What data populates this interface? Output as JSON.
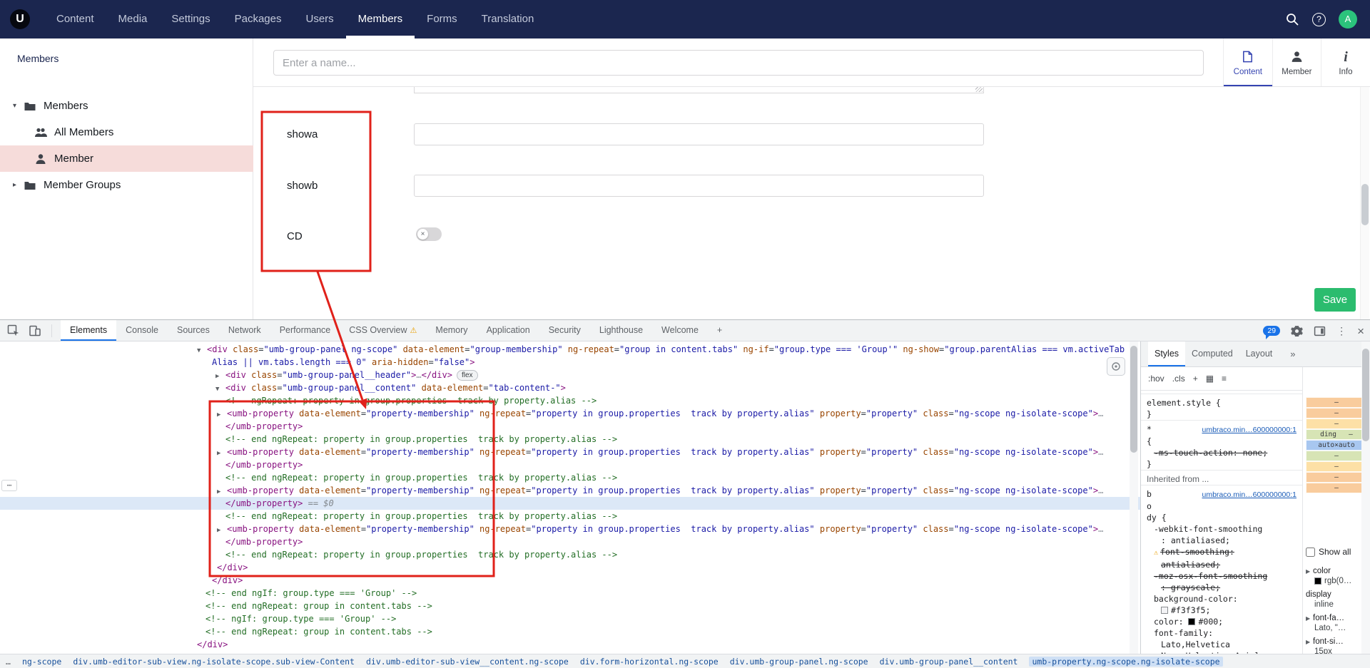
{
  "colors": {
    "header_bg": "#1b264f",
    "accent_blue": "#3544b1",
    "save_green": "#2bbc6e",
    "annotation_red": "#e0211a",
    "selected_tree_bg": "#f6dcda",
    "devtools_blue": "#1a73e8"
  },
  "topnav": {
    "logo_text": "U",
    "items": [
      "Content",
      "Media",
      "Settings",
      "Packages",
      "Users",
      "Members",
      "Forms",
      "Translation"
    ],
    "active_item": "Members",
    "avatar_initial": "A",
    "help_glyph": "?"
  },
  "sidebar": {
    "title": "Members",
    "tree": [
      {
        "label": "Members",
        "icon": "folder-icon",
        "caret": "▾",
        "child": false,
        "selected": false
      },
      {
        "label": "All Members",
        "icon": "members-icon",
        "child": true,
        "selected": false
      },
      {
        "label": "Member",
        "icon": "user-icon",
        "child": true,
        "selected": true
      },
      {
        "label": "Member Groups",
        "icon": "folder-icon",
        "caret": "▸",
        "child": false,
        "selected": false
      }
    ]
  },
  "editor": {
    "name_placeholder": "Enter a name...",
    "subtabs": [
      {
        "label": "Content",
        "icon": "document-icon",
        "active": true
      },
      {
        "label": "Member",
        "icon": "person-icon",
        "active": false
      },
      {
        "label": "Info",
        "icon": "info-icon",
        "active": false
      }
    ],
    "fields": [
      {
        "label": "showa",
        "type": "text",
        "value": ""
      },
      {
        "label": "showb",
        "type": "text",
        "value": ""
      },
      {
        "label": "CD",
        "type": "toggle",
        "state": "off",
        "knob_glyph": "×"
      }
    ],
    "save_label": "Save"
  },
  "devtools": {
    "tabs": [
      {
        "label": "Elements",
        "active": true
      },
      {
        "label": "Console"
      },
      {
        "label": "Sources"
      },
      {
        "label": "Network"
      },
      {
        "label": "Performance"
      },
      {
        "label": "CSS Overview",
        "warn": true
      },
      {
        "label": "Memory"
      },
      {
        "label": "Application"
      },
      {
        "label": "Security"
      },
      {
        "label": "Lighthouse"
      },
      {
        "label": "Welcome"
      },
      {
        "label": "+"
      }
    ],
    "issues_count": "29",
    "more_dots": "⋯",
    "close_glyph": "×",
    "kebab_glyph": "⋮",
    "code_lines": [
      {
        "ind": 0,
        "arrow": "▼",
        "toks": [
          [
            "t",
            "<div"
          ],
          [
            "at",
            " class"
          ],
          [
            "p",
            "="
          ],
          [
            "s",
            "\"umb-group-panel ng-scope\""
          ],
          [
            "at",
            " data-element"
          ],
          [
            "p",
            "="
          ],
          [
            "s",
            "\"group-membership\""
          ],
          [
            "at",
            " ng-repeat"
          ],
          [
            "p",
            "="
          ],
          [
            "s",
            "\"group in content.tabs\""
          ],
          [
            "at",
            " ng-if"
          ],
          [
            "p",
            "="
          ],
          [
            "s",
            "\"group.type === 'Group'\""
          ],
          [
            "at",
            " ng-show"
          ],
          [
            "p",
            "="
          ],
          [
            "s",
            "\"group.parentAlias === vm.activeTab"
          ]
        ]
      },
      {
        "ind": 21,
        "toks": [
          [
            "s",
            "Alias || vm.tabs.length === 0\""
          ],
          [
            "at",
            " aria-hidden"
          ],
          [
            "p",
            "="
          ],
          [
            "s",
            "\"false\""
          ],
          [
            "t",
            ">"
          ]
        ]
      },
      {
        "ind": 26,
        "arrow": "▶",
        "toks": [
          [
            "t",
            "<div"
          ],
          [
            "at",
            " class"
          ],
          [
            "p",
            "="
          ],
          [
            "s",
            "\"umb-group-panel__header\""
          ],
          [
            "t",
            ">"
          ],
          [
            "e",
            "…"
          ],
          [
            "t",
            "</div>"
          ],
          [
            "b",
            "flex"
          ]
        ]
      },
      {
        "ind": 26,
        "arrow": "▼",
        "toks": [
          [
            "t",
            "<div"
          ],
          [
            "at",
            " class"
          ],
          [
            "p",
            "="
          ],
          [
            "s",
            "\"umb-group-panel__content\""
          ],
          [
            "at",
            " data-element"
          ],
          [
            "p",
            "="
          ],
          [
            "s",
            "\"tab-content-\""
          ],
          [
            "t",
            ">"
          ]
        ]
      },
      {
        "ind": 40,
        "toks": [
          [
            "c",
            "<!-- ngRepeat: property in group.properties  track by property.alias -->"
          ]
        ]
      },
      {
        "ind": 28,
        "arrow": "▶",
        "toks": [
          [
            "t",
            "<umb-property"
          ],
          [
            "at",
            " data-element"
          ],
          [
            "p",
            "="
          ],
          [
            "s",
            "\"property-membership\""
          ],
          [
            "at",
            " ng-repeat"
          ],
          [
            "p",
            "="
          ],
          [
            "s",
            "\"property in group.properties  track by property.alias\""
          ],
          [
            "at",
            " property"
          ],
          [
            "p",
            "="
          ],
          [
            "s",
            "\"property\""
          ],
          [
            "at",
            " class"
          ],
          [
            "p",
            "="
          ],
          [
            "s",
            "\"ng-scope ng-isolate-scope\""
          ],
          [
            "t",
            ">"
          ],
          [
            "e",
            "…"
          ]
        ]
      },
      {
        "ind": 40,
        "toks": [
          [
            "t",
            "</umb-property>"
          ]
        ]
      },
      {
        "ind": 40,
        "toks": [
          [
            "c",
            "<!-- end ngRepeat: property in group.properties  track by property.alias -->"
          ]
        ]
      },
      {
        "ind": 28,
        "arrow": "▶",
        "toks": [
          [
            "t",
            "<umb-property"
          ],
          [
            "at",
            " data-element"
          ],
          [
            "p",
            "="
          ],
          [
            "s",
            "\"property-membership\""
          ],
          [
            "at",
            " ng-repeat"
          ],
          [
            "p",
            "="
          ],
          [
            "s",
            "\"property in group.properties  track by property.alias\""
          ],
          [
            "at",
            " property"
          ],
          [
            "p",
            "="
          ],
          [
            "s",
            "\"property\""
          ],
          [
            "at",
            " class"
          ],
          [
            "p",
            "="
          ],
          [
            "s",
            "\"ng-scope ng-isolate-scope\""
          ],
          [
            "t",
            ">"
          ],
          [
            "e",
            "…"
          ]
        ]
      },
      {
        "ind": 40,
        "toks": [
          [
            "t",
            "</umb-property>"
          ]
        ]
      },
      {
        "ind": 40,
        "toks": [
          [
            "c",
            "<!-- end ngRepeat: property in group.properties  track by property.alias -->"
          ]
        ]
      },
      {
        "ind": 28,
        "arrow": "▶",
        "toks": [
          [
            "t",
            "<umb-property"
          ],
          [
            "at",
            " data-element"
          ],
          [
            "p",
            "="
          ],
          [
            "s",
            "\"property-membership\""
          ],
          [
            "at",
            " ng-repeat"
          ],
          [
            "p",
            "="
          ],
          [
            "s",
            "\"property in group.properties  track by property.alias\""
          ],
          [
            "at",
            " property"
          ],
          [
            "p",
            "="
          ],
          [
            "s",
            "\"property\""
          ],
          [
            "at",
            " class"
          ],
          [
            "p",
            "="
          ],
          [
            "s",
            "\"ng-scope ng-isolate-scope\""
          ],
          [
            "t",
            ">"
          ],
          [
            "e",
            "…"
          ]
        ]
      },
      {
        "ind": 40,
        "sel": true,
        "toks": [
          [
            "t",
            "</umb-property>"
          ],
          [
            "g",
            " == $0"
          ]
        ]
      },
      {
        "ind": 40,
        "toks": [
          [
            "c",
            "<!-- end ngRepeat: property in group.properties  track by property.alias -->"
          ]
        ]
      },
      {
        "ind": 28,
        "arrow": "▶",
        "toks": [
          [
            "t",
            "<umb-property"
          ],
          [
            "at",
            " data-element"
          ],
          [
            "p",
            "="
          ],
          [
            "s",
            "\"property-membership\""
          ],
          [
            "at",
            " ng-repeat"
          ],
          [
            "p",
            "="
          ],
          [
            "s",
            "\"property in group.properties  track by property.alias\""
          ],
          [
            "at",
            " property"
          ],
          [
            "p",
            "="
          ],
          [
            "s",
            "\"property\""
          ],
          [
            "at",
            " class"
          ],
          [
            "p",
            "="
          ],
          [
            "s",
            "\"ng-scope ng-isolate-scope\""
          ],
          [
            "t",
            ">"
          ],
          [
            "e",
            "…"
          ]
        ]
      },
      {
        "ind": 40,
        "toks": [
          [
            "t",
            "</umb-property>"
          ]
        ]
      },
      {
        "ind": 40,
        "toks": [
          [
            "c",
            "<!-- end ngRepeat: property in group.properties  track by property.alias -->"
          ]
        ]
      },
      {
        "ind": 28,
        "toks": [
          [
            "t",
            "</div>"
          ]
        ]
      },
      {
        "ind": 21,
        "toks": [
          [
            "t",
            "</div>"
          ]
        ]
      },
      {
        "ind": 12,
        "toks": [
          [
            "c",
            "<!-- end ngIf: group.type === 'Group' -->"
          ]
        ]
      },
      {
        "ind": 12,
        "toks": [
          [
            "c",
            "<!-- end ngRepeat: group in content.tabs -->"
          ]
        ]
      },
      {
        "ind": 12,
        "toks": [
          [
            "c",
            "<!-- ngIf: group.type === 'Group' -->"
          ]
        ]
      },
      {
        "ind": 12,
        "toks": [
          [
            "c",
            "<!-- end ngRepeat: group in content.tabs -->"
          ]
        ]
      },
      {
        "ind": 0,
        "toks": [
          [
            "t",
            "</div>"
          ]
        ]
      }
    ],
    "styles_pane": {
      "tabs": [
        {
          "label": "Styles",
          "active": true
        },
        {
          "label": "Computed"
        },
        {
          "label": "Layout"
        }
      ],
      "overflow_glyph": "»",
      "filter_items": [
        ":hov",
        ".cls",
        "+",
        "▦",
        "≡"
      ],
      "rows": [
        {
          "pre": "element.style {",
          "cls": "sel",
          "sep": true
        },
        {
          "pre": "}"
        },
        {
          "pre": "*",
          "cls": "sel",
          "link": "umbraco.min…600000000:1",
          "sep": true
        },
        {
          "pre": "{"
        },
        {
          "pre": "-ms-touch-action: none;",
          "struck": true,
          "ind": 1
        },
        {
          "pre": "}"
        },
        {
          "pre": "Inherited from ...",
          "cls": "section",
          "sep": true
        },
        {
          "pre": "b",
          "cls": "sel",
          "link": "umbraco.min…600000000:1",
          "sep": true
        },
        {
          "pre": "o",
          "cls": "sel"
        },
        {
          "pre": "dy {",
          "cls": "sel"
        },
        {
          "pre": "-webkit-font-smoothing",
          "ind": 1
        },
        {
          "pre": ": antialiased;",
          "ind": 2
        },
        {
          "pre": "font-smoothing:",
          "struck": true,
          "warn": true,
          "ind": 1
        },
        {
          "pre": "antialiased;",
          "struck": true,
          "ind": 2
        },
        {
          "pre": "-moz-osx-font-smoothing",
          "struck": true,
          "ind": 1
        },
        {
          "pre": ": grayscale;",
          "struck": true,
          "ind": 2
        },
        {
          "pre": "background-color:",
          "ind": 1
        },
        {
          "swatch": "#f3f3f5",
          "post": "#f3f3f5;",
          "ind": 2
        },
        {
          "pre": "color: ",
          "swatch": "#000000",
          "post": "#000;",
          "ind": 1
        },
        {
          "pre": "font-family:",
          "ind": 1
        },
        {
          "pre": "Lato,Helvetica",
          "ind": 2
        },
        {
          "pre": "Neue,Helvetica,Arial,",
          "ind": 2
        }
      ]
    },
    "computed_pane": {
      "box_model_rows": [
        {
          "text": "–",
          "color": "#f9cc9d"
        },
        {
          "text": "–",
          "color": "#f9cc9d"
        },
        {
          "text": "–",
          "color": "#fde0a6"
        },
        {
          "text": "ding   –",
          "color": "#d7e4b5"
        },
        {
          "text": "auto×auto",
          "color": "#a8c7f0"
        },
        {
          "text": "–",
          "color": "#d7e4b5"
        },
        {
          "text": "–",
          "color": "#fde0a6"
        },
        {
          "text": "–",
          "color": "#f9cc9d"
        },
        {
          "text": "–",
          "color": "#f9cc9d"
        }
      ],
      "show_all_label": "Show all",
      "entries": [
        {
          "name": "color",
          "swatch": "#000000",
          "value": "rgb(0…",
          "arrow": true
        },
        {
          "name": "display",
          "value": "inline",
          "arrow": false
        },
        {
          "name": "font-fa…",
          "value": "Lato, \"…",
          "arrow": true
        },
        {
          "name": "font-si…",
          "value": "15px",
          "arrow": true
        }
      ]
    },
    "breadcrumbs": {
      "overflow": "…",
      "crumbs": [
        "ng-scope",
        "div.umb-editor-sub-view.ng-isolate-scope.sub-view-Content",
        "div.umb-editor-sub-view__content.ng-scope",
        "div.form-horizontal.ng-scope",
        "div.umb-group-panel.ng-scope",
        "div.umb-group-panel__content",
        "umb-property.ng-scope.ng-isolate-scope"
      ],
      "active_crumb": "umb-property.ng-scope.ng-isolate-scope"
    }
  }
}
